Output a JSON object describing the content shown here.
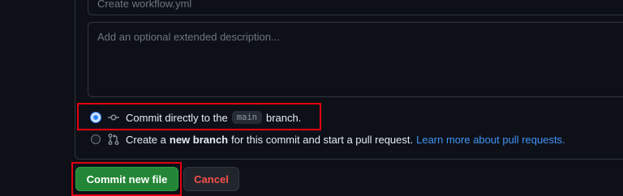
{
  "commit_form": {
    "title_placeholder": "Create workflow.yml",
    "description_placeholder": "Add an optional extended description..."
  },
  "options": {
    "direct": {
      "label_before": "Commit directly to the",
      "branch": "main",
      "label_after": "branch.",
      "selected": true,
      "icon": "git-commit-icon"
    },
    "new_branch": {
      "label_before": "Create a",
      "label_bold": "new branch",
      "label_after": "for this commit and start a pull request.",
      "link": "Learn more about pull requests.",
      "selected": false,
      "icon": "git-pull-request-icon"
    }
  },
  "buttons": {
    "commit": "Commit new file",
    "cancel": "Cancel"
  },
  "colors": {
    "background": "#0d1117",
    "border": "#30363d",
    "primary_button": "#238636",
    "danger_text": "#f85149",
    "link": "#4493f8",
    "highlight": "#e3000f"
  }
}
